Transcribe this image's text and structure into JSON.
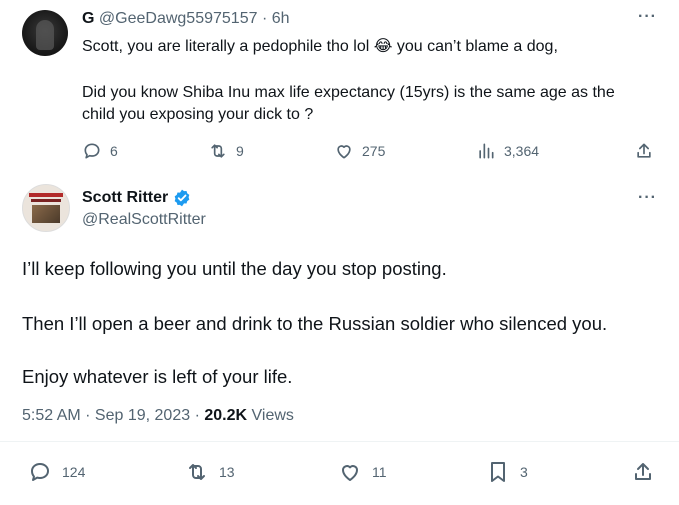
{
  "reply": {
    "author_name": "G",
    "handle": "@GeeDawg55975157",
    "time": "· 6h",
    "line1_a": "Scott, you are literally a pedophile tho lol",
    "emoji": "😂",
    "line1_b": "you can’t blame a dog,",
    "line2": "Did you know Shiba Inu max life expectancy (15yrs) is the same age as the",
    "line3": "child you exposing your dick to ?",
    "replies": "6",
    "reposts": "9",
    "likes": "275",
    "views": "3,364"
  },
  "main": {
    "author_name": "Scott Ritter",
    "handle": "@RealScottRitter",
    "para1": "I’ll keep following you until the day you stop posting.",
    "para2": "Then I’ll open a beer and drink to the Russian soldier who silenced you.",
    "para3": "Enjoy whatever is left of your life.",
    "time_date": "5:52 AM · Sep 19, 2023 ·",
    "views_count": "20.2K",
    "views_label": "Views",
    "replies": "124",
    "reposts": "13",
    "likes": "11",
    "bookmarks": "3"
  },
  "icons": {
    "more": "more-icon",
    "reply": "reply-icon",
    "repost": "repost-icon",
    "like": "like-icon",
    "views": "views-icon",
    "share": "share-icon",
    "bookmark": "bookmark-icon",
    "verified": "verified-badge-icon"
  },
  "colors": {
    "text": "#0f1419",
    "muted": "#536471",
    "verified": "#1d9bf0"
  }
}
